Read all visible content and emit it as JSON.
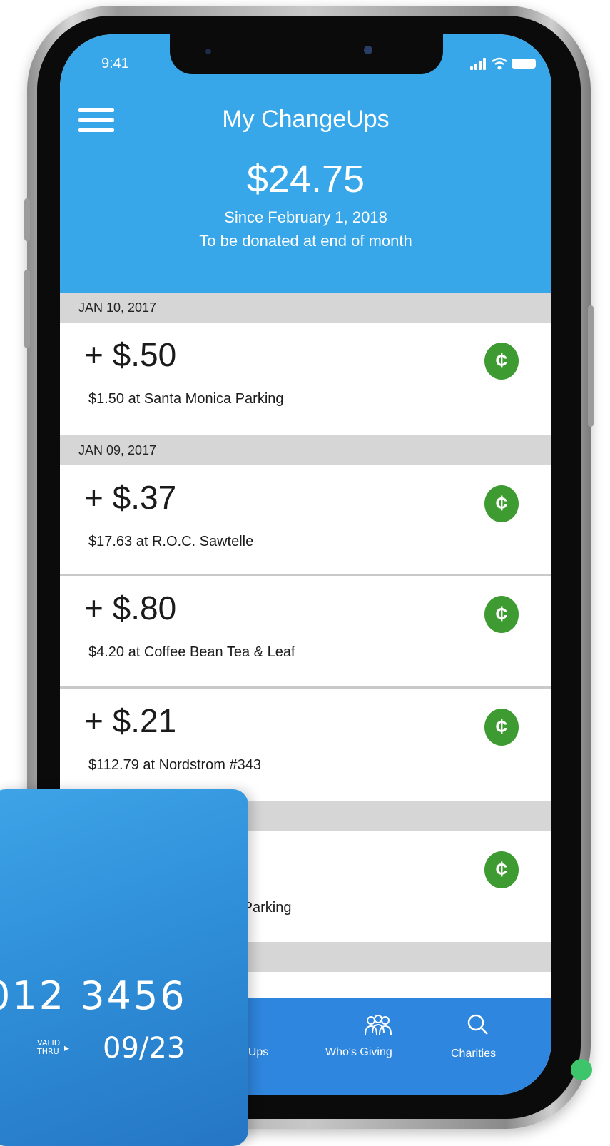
{
  "status_bar": {
    "time": "9:41"
  },
  "header": {
    "title": "My ChangeUps",
    "total": "$24.75",
    "since": "Since February 1, 2018",
    "note": "To be donated at end of month"
  },
  "groups": [
    {
      "date": "JAN 10, 2017",
      "items": [
        {
          "amount": "+ $.50",
          "description": "$1.50 at Santa Monica Parking"
        }
      ]
    },
    {
      "date": "JAN 09, 2017",
      "items": [
        {
          "amount": "+ $.37",
          "description": "$17.63 at R.O.C. Sawtelle"
        },
        {
          "amount": "+ $.80",
          "description": "$4.20 at Coffee Bean Tea & Leaf"
        },
        {
          "amount": "+ $.21",
          "description": "$112.79 at Nordstrom #343"
        }
      ]
    },
    {
      "date": "",
      "items": [
        {
          "amount": "",
          "description": "ca Parking"
        }
      ]
    }
  ],
  "tabbar": {
    "tabs": [
      {
        "label": "geUps",
        "icon": "changeups-icon"
      },
      {
        "label": "Who's Giving",
        "icon": "people-icon"
      },
      {
        "label": "Charities",
        "icon": "search-icon"
      }
    ]
  },
  "card": {
    "number_partial": "012  3456",
    "valid_thru_label": "VALID THRU",
    "expiry": "09/23"
  },
  "colors": {
    "header_blue": "#37a7ea",
    "tabbar_blue": "#2f86de",
    "cent_green": "#3e9b31",
    "date_header_gray": "#d6d6d6"
  }
}
